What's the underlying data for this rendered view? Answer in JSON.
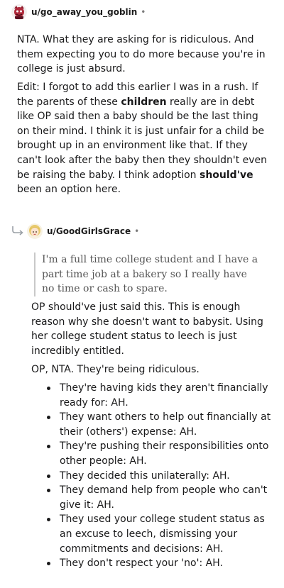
{
  "comment1": {
    "username": "u/go_away_you_goblin",
    "dot": "•",
    "p1": "NTA. What they are asking for is ridiculous. And them expecting you to do more because you're in college is just absurd.",
    "p2": {
      "a": "Edit: I forgot to add this earlier I was in a rush. If the parents of these ",
      "b": "children",
      "c": " really are in debt like OP said then a baby should be the last thing on their mind. I think it is just unfair for a child be brought up in an environment like that. If they can't look after the baby then they shouldn't even be raising the baby. I think adoption ",
      "d": "should've",
      "e": " been an option here."
    }
  },
  "comment2": {
    "username": "u/GoodGirlsGrace",
    "dot": "•",
    "quote": "I'm a full time college student and I have a part time job at a bakery so I really have no time or cash to spare.",
    "p1": "OP should've just said this. This is enough reason why she doesn't want to babysit. Using her college student status to leech is just incredibly entitled.",
    "p2": "OP, NTA. They're being ridiculous.",
    "bullets": [
      "They're having kids they aren't financially ready for: AH.",
      "They want others to help out financially at their (others') expense: AH.",
      "They're pushing their responsibilities onto other people: AH.",
      "They decided this unilaterally: AH.",
      "They demand help from people who can't give it: AH.",
      "They used your college student status as an excuse to leech, dismissing your commitments and decisions: AH.",
      "They don't respect your 'no': AH."
    ]
  },
  "colors": {
    "text": "#1a1a1b",
    "quote_text": "#555555",
    "quote_border": "#c8c8c8",
    "meta": "#7c7c7c"
  },
  "icons": {
    "avatar1": "goblin-avatar",
    "avatar2": "blonde-girl-avatar",
    "reply": "reply-arrow-icon"
  }
}
